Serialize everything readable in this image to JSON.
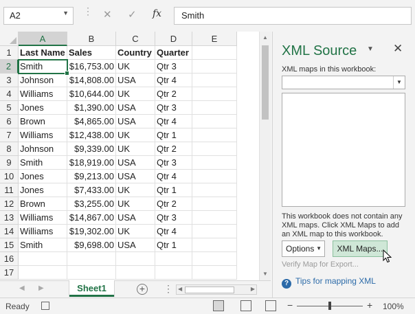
{
  "formula_bar": {
    "name_box": "A2",
    "cancel_glyph": "✕",
    "enter_glyph": "✓",
    "fx_label": "fx",
    "formula_value": "Smith"
  },
  "grid": {
    "columns": [
      "A",
      "B",
      "C",
      "D",
      "E"
    ],
    "row_numbers": [
      "1",
      "2",
      "3",
      "4",
      "5",
      "6",
      "7",
      "8",
      "9",
      "10",
      "11",
      "12",
      "13",
      "14",
      "15",
      "16",
      "17"
    ],
    "rows": [
      [
        "Last Name",
        "Sales",
        "Country",
        "Quarter",
        ""
      ],
      [
        "Smith",
        "$16,753.00",
        "UK",
        "Qtr 3",
        ""
      ],
      [
        "Johnson",
        "$14,808.00",
        "USA",
        "Qtr 4",
        ""
      ],
      [
        "Williams",
        "$10,644.00",
        "UK",
        "Qtr 2",
        ""
      ],
      [
        "Jones",
        "$1,390.00",
        "USA",
        "Qtr 3",
        ""
      ],
      [
        "Brown",
        "$4,865.00",
        "USA",
        "Qtr 4",
        ""
      ],
      [
        "Williams",
        "$12,438.00",
        "UK",
        "Qtr 1",
        ""
      ],
      [
        "Johnson",
        "$9,339.00",
        "UK",
        "Qtr 2",
        ""
      ],
      [
        "Smith",
        "$18,919.00",
        "USA",
        "Qtr 3",
        ""
      ],
      [
        "Jones",
        "$9,213.00",
        "USA",
        "Qtr 4",
        ""
      ],
      [
        "Jones",
        "$7,433.00",
        "UK",
        "Qtr 1",
        ""
      ],
      [
        "Brown",
        "$3,255.00",
        "UK",
        "Qtr 2",
        ""
      ],
      [
        "Williams",
        "$14,867.00",
        "USA",
        "Qtr 3",
        ""
      ],
      [
        "Williams",
        "$19,302.00",
        "UK",
        "Qtr 4",
        ""
      ],
      [
        "Smith",
        "$9,698.00",
        "USA",
        "Qtr 1",
        ""
      ],
      [
        "",
        "",
        "",
        "",
        ""
      ],
      [
        "",
        "",
        "",
        "",
        ""
      ]
    ],
    "selected_column": "A",
    "selected_row": "2"
  },
  "sheet_tabs": {
    "active": "Sheet1"
  },
  "xml_pane": {
    "title": "XML Source",
    "maps_label": "XML maps in this workbook:",
    "info_text": "This workbook does not contain any XML maps. Click XML Maps to add an XML map to this workbook.",
    "options_label": "Options",
    "xml_maps_label": "XML Maps...",
    "verify_label": "Verify Map for Export...",
    "help_label": "Tips for mapping XML"
  },
  "status_bar": {
    "ready": "Ready",
    "zoom_minus": "−",
    "zoom_plus": "+",
    "zoom": "100%"
  },
  "colors": {
    "accent": "#217346",
    "link": "#2b6aa8"
  }
}
